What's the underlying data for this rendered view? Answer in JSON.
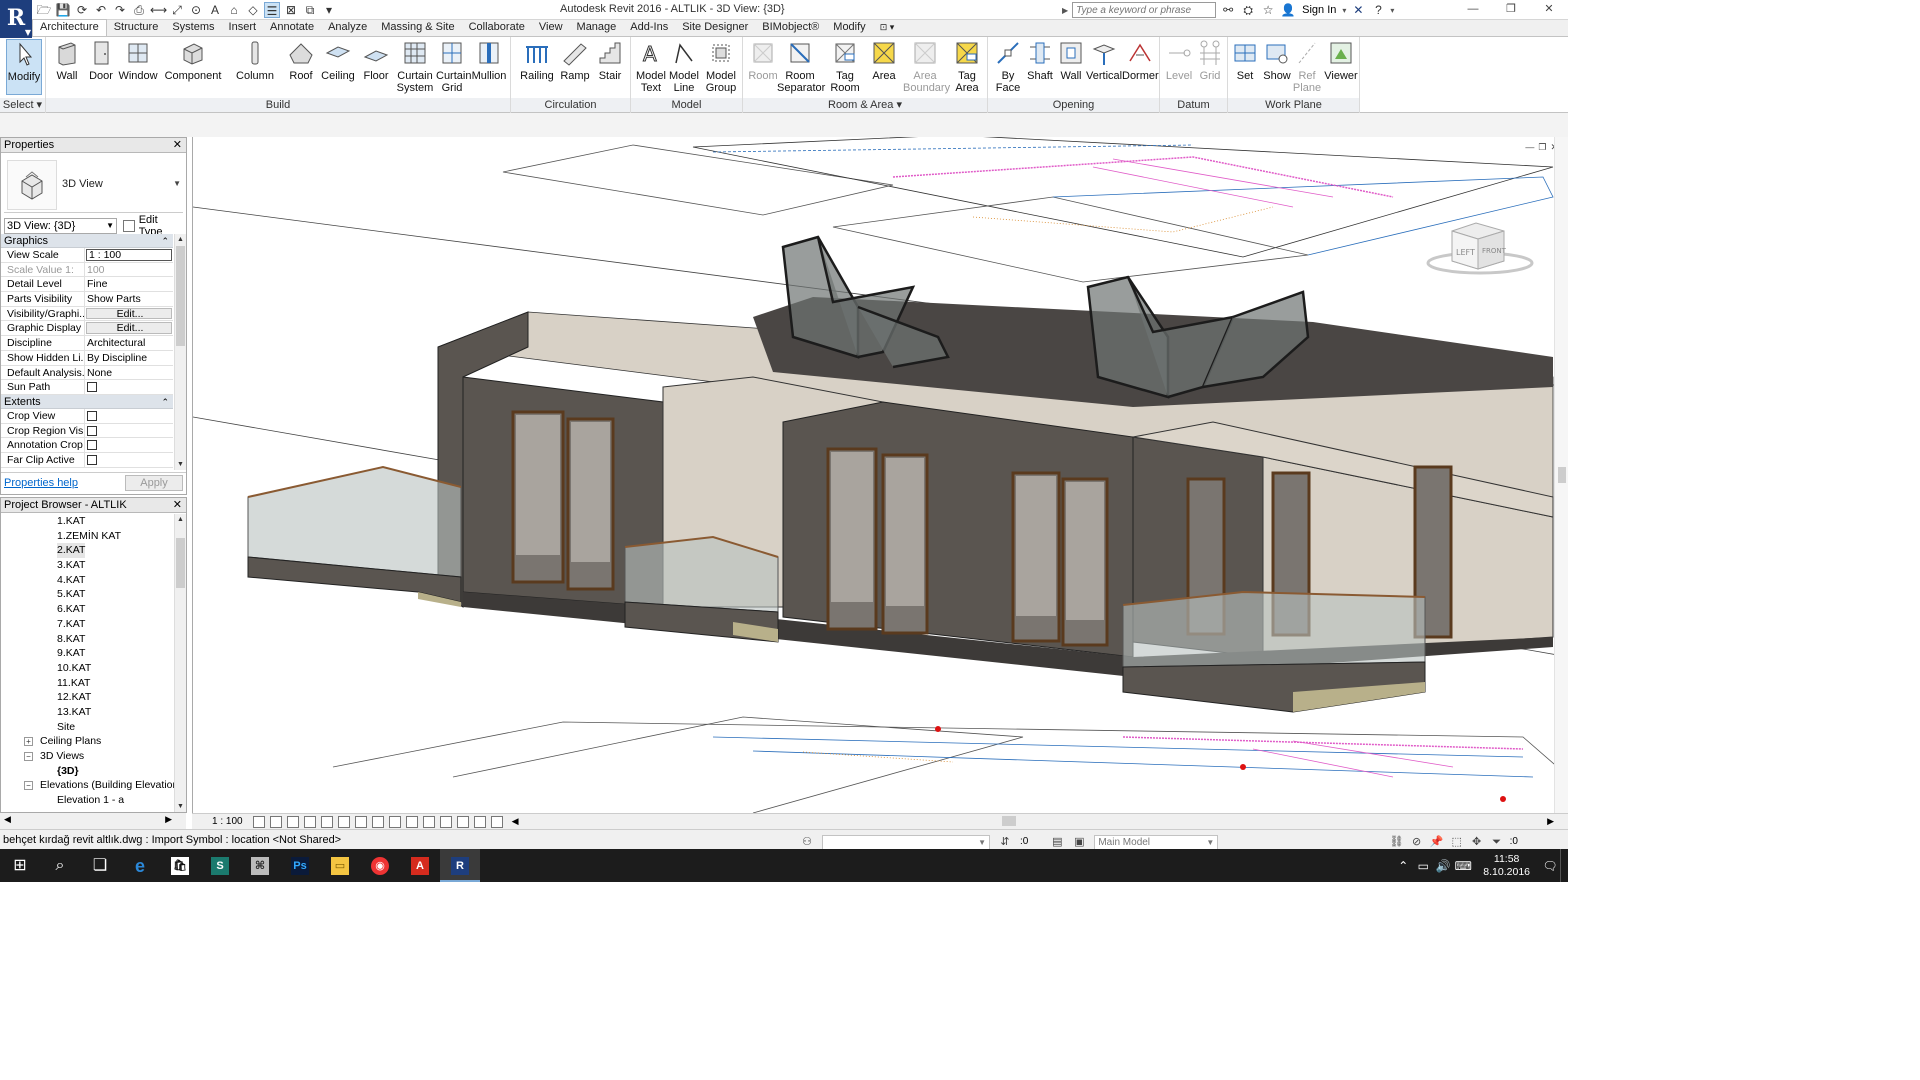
{
  "app": {
    "logo": "R",
    "title": "Autodesk Revit 2016 -    ALTLIK - 3D View: {3D}",
    "search_placeholder": "Type a keyword or phrase",
    "sign_in": "Sign In"
  },
  "ribbon": {
    "tabs": [
      "Architecture",
      "Structure",
      "Systems",
      "Insert",
      "Annotate",
      "Analyze",
      "Massing & Site",
      "Collaborate",
      "View",
      "Manage",
      "Add-Ins",
      "Site Designer",
      "BIMobject®",
      "Modify"
    ],
    "active_tab": "Architecture",
    "groups": [
      {
        "label": "Select ▾",
        "buttons": [
          {
            "label": "Modify"
          }
        ]
      },
      {
        "label": "Build",
        "buttons": [
          {
            "label": "Wall"
          },
          {
            "label": "Door"
          },
          {
            "label": "Window"
          },
          {
            "label": "Component"
          },
          {
            "label": "Column"
          },
          {
            "label": "Roof"
          },
          {
            "label": "Ceiling"
          },
          {
            "label": "Floor"
          },
          {
            "label": "Curtain System"
          },
          {
            "label": "Curtain Grid"
          },
          {
            "label": "Mullion"
          }
        ]
      },
      {
        "label": "Circulation",
        "buttons": [
          {
            "label": "Railing"
          },
          {
            "label": "Ramp"
          },
          {
            "label": "Stair"
          }
        ]
      },
      {
        "label": "Model",
        "buttons": [
          {
            "label": "Model Text"
          },
          {
            "label": "Model Line"
          },
          {
            "label": "Model Group"
          }
        ]
      },
      {
        "label": "Room & Area ▾",
        "buttons": [
          {
            "label": "Room"
          },
          {
            "label": "Room Separator"
          },
          {
            "label": "Tag Room"
          },
          {
            "label": "Area"
          },
          {
            "label": "Area Boundary"
          },
          {
            "label": "Tag Area"
          }
        ]
      },
      {
        "label": "Opening",
        "buttons": [
          {
            "label": "By Face"
          },
          {
            "label": "Shaft"
          },
          {
            "label": "Wall"
          },
          {
            "label": "Vertical"
          },
          {
            "label": "Dormer"
          }
        ]
      },
      {
        "label": "Datum",
        "buttons": [
          {
            "label": "Level"
          },
          {
            "label": "Grid"
          }
        ]
      },
      {
        "label": "Work Plane",
        "buttons": [
          {
            "label": "Set"
          },
          {
            "label": "Show"
          },
          {
            "label": "Ref Plane"
          },
          {
            "label": "Viewer"
          }
        ]
      }
    ]
  },
  "properties": {
    "title": "Properties",
    "type_name": "3D View",
    "instance_selector": "3D View: {3D}",
    "edit_type": "Edit Type",
    "sections": {
      "graphics": "Graphics",
      "extents": "Extents"
    },
    "graphics_rows": [
      {
        "name": "View Scale",
        "value": "1 : 100"
      },
      {
        "name": "Scale Value    1:",
        "value": "100"
      },
      {
        "name": "Detail Level",
        "value": "Fine"
      },
      {
        "name": "Parts Visibility",
        "value": "Show Parts"
      },
      {
        "name": "Visibility/Graphi...",
        "value": "Edit..."
      },
      {
        "name": "Graphic Display ...",
        "value": "Edit..."
      },
      {
        "name": "Discipline",
        "value": "Architectural"
      },
      {
        "name": "Show Hidden Li...",
        "value": "By Discipline"
      },
      {
        "name": "Default Analysis...",
        "value": "None"
      },
      {
        "name": "Sun Path",
        "value": ""
      }
    ],
    "extents_rows": [
      {
        "name": "Crop View",
        "value": ""
      },
      {
        "name": "Crop Region Vis...",
        "value": ""
      },
      {
        "name": "Annotation Crop",
        "value": ""
      },
      {
        "name": "Far Clip Active",
        "value": ""
      }
    ],
    "help_link": "Properties help",
    "apply": "Apply"
  },
  "browser": {
    "title": "Project Browser - ALTLIK",
    "nodes": [
      {
        "label": "1.KAT",
        "indent": 56
      },
      {
        "label": "1.ZEMİN KAT",
        "indent": 56
      },
      {
        "label": "2.KAT",
        "indent": 56,
        "selected": true
      },
      {
        "label": "3.KAT",
        "indent": 56
      },
      {
        "label": "4.KAT",
        "indent": 56
      },
      {
        "label": "5.KAT",
        "indent": 56
      },
      {
        "label": "6.KAT",
        "indent": 56
      },
      {
        "label": "7.KAT",
        "indent": 56
      },
      {
        "label": "8.KAT",
        "indent": 56
      },
      {
        "label": "9.KAT",
        "indent": 56
      },
      {
        "label": "10.KAT",
        "indent": 56
      },
      {
        "label": "11.KAT",
        "indent": 56
      },
      {
        "label": "12.KAT",
        "indent": 56
      },
      {
        "label": "13.KAT",
        "indent": 56
      },
      {
        "label": "Site",
        "indent": 56
      },
      {
        "label": "Ceiling Plans",
        "indent": 39,
        "expander": "+"
      },
      {
        "label": "3D Views",
        "indent": 39,
        "expander": "−"
      },
      {
        "label": "{3D}",
        "indent": 56,
        "bold": true
      },
      {
        "label": "Elevations (Building Elevation)",
        "indent": 39,
        "expander": "−"
      },
      {
        "label": "Elevation 1 - a",
        "indent": 56
      }
    ]
  },
  "viewcube": {
    "left": "LEFT",
    "front": "FRONT"
  },
  "view_control": {
    "scale": "1 : 100"
  },
  "status": {
    "text": "behçet kırdağ revit altlık.dwg : Import Symbol : location <Not Shared>",
    "workset_count": ":0",
    "model": "Main Model",
    "filter_count": ":0"
  },
  "taskbar": {
    "time": "11:58",
    "date": "8.10.2016"
  },
  "colors": {
    "revit_blue": "#1e3e7d",
    "wall_dark": "#5a5550",
    "wall_light": "#d8d1c6",
    "floor_tan": "#b8b08a"
  }
}
